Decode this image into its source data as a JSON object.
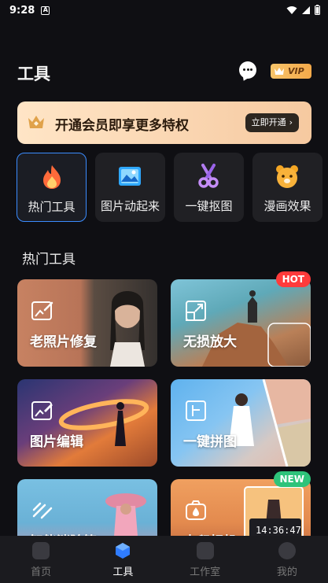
{
  "status_bar": {
    "time": "9:28",
    "notification_icon": "A"
  },
  "header": {
    "title": "工具",
    "vip_label": "VIP"
  },
  "vip_banner": {
    "text": "开通会员即享更多特权",
    "button_label": "立即开通",
    "accent": "#f6c9a0"
  },
  "categories": [
    {
      "label": "热门工具",
      "icon": "flame-icon",
      "selected": true
    },
    {
      "label": "图片动起来",
      "icon": "image-icon",
      "selected": false
    },
    {
      "label": "一键抠图",
      "icon": "scissors-icon",
      "selected": false
    },
    {
      "label": "漫画效果",
      "icon": "bear-icon",
      "selected": false
    }
  ],
  "section_title": "热门工具",
  "tools": [
    {
      "label": "老照片修复",
      "icon": "photo-repair-icon",
      "badge": ""
    },
    {
      "label": "无损放大",
      "icon": "enlarge-icon",
      "badge": "HOT"
    },
    {
      "label": "图片编辑",
      "icon": "photo-edit-icon",
      "badge": ""
    },
    {
      "label": "一键拼图",
      "icon": "collage-icon",
      "badge": ""
    },
    {
      "label": "智能消除笔",
      "icon": "eraser-icon",
      "badge": ""
    },
    {
      "label": "去印相机",
      "icon": "camera-icon",
      "badge": "NEW"
    }
  ],
  "watermark_clock": "14:36:47",
  "tab_bar": {
    "tabs": [
      {
        "label": "首页",
        "active": false
      },
      {
        "label": "工具",
        "active": true
      },
      {
        "label": "工作室",
        "active": false
      },
      {
        "label": "我的",
        "active": false
      }
    ]
  },
  "colors": {
    "background": "#0f0f13",
    "accent_blue": "#3b8cff",
    "hot": "#ff3b3b",
    "new": "#2ec37a"
  }
}
